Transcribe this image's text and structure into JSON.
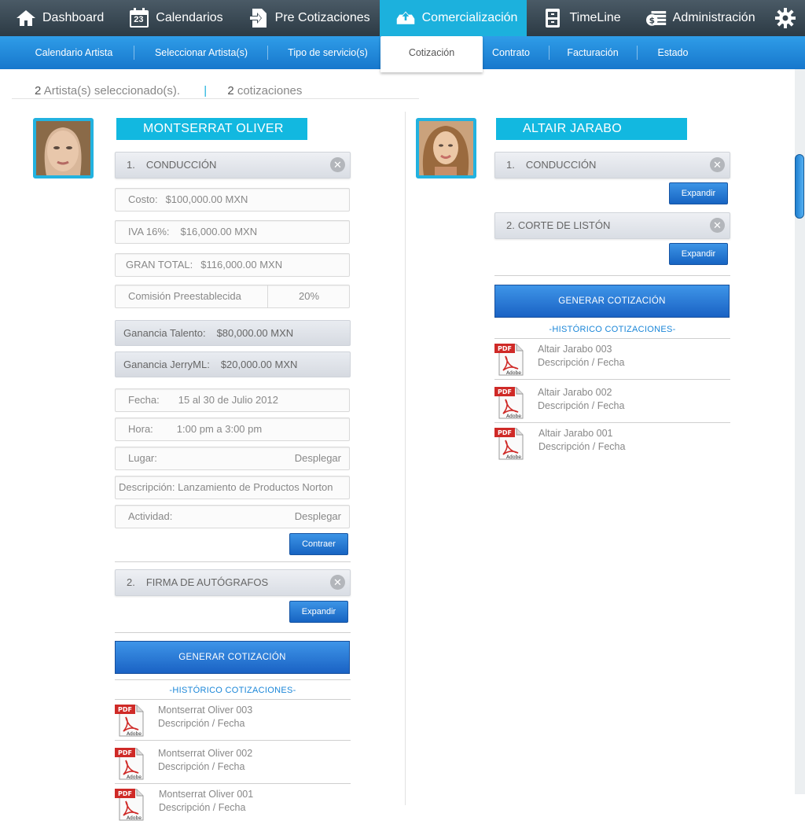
{
  "nav": {
    "items": [
      {
        "label": "Dashboard",
        "icon": "home-icon"
      },
      {
        "label": "Calendarios",
        "icon": "calendar-icon",
        "badge": "23"
      },
      {
        "label": "Pre Cotizaciones",
        "icon": "document-arrow-icon"
      },
      {
        "label": "Comercialización",
        "icon": "cloud-upload-icon"
      },
      {
        "label": "TimeLine",
        "icon": "cabinet-icon"
      },
      {
        "label": "Administración",
        "icon": "money-icon"
      }
    ],
    "active": "Comercialización",
    "settings_icon": "gear-icon"
  },
  "subnav": {
    "items": [
      "Calendario Artista",
      "Seleccionar Artista(s)",
      "Tipo de servicio(s)",
      "Cotización",
      "Contrato",
      "Facturación",
      "Estado"
    ],
    "active": "Cotización"
  },
  "summary": {
    "artists_count": "2",
    "artists_text": "Artista(s) seleccionado(s).",
    "divider": "|",
    "quotes_count": "2",
    "quotes_text": "cotizaciones"
  },
  "artists": [
    {
      "name": "MONTSERRAT OLIVER",
      "services": [
        {
          "num": "1.",
          "label": "CONDUCCIÓN"
        },
        {
          "num": "2.",
          "label": "FIRMA DE AUTÓGRAFOS"
        }
      ],
      "details": {
        "costo_label": "Costo:",
        "costo": "$100,000.00  MXN",
        "iva_label": "IVA 16%:",
        "iva": "$16,000.00 MXN",
        "total_label": "GRAN TOTAL:",
        "total": "$116,000.00  MXN",
        "comision_label": "Comisión Preestablecida",
        "comision": "20%",
        "ganancia_talento_label": "Ganancia Talento:",
        "ganancia_talento": "$80,000.00 MXN",
        "ganancia_jerry_label": "Ganancia JerryML:",
        "ganancia_jerry": "$20,000.00 MXN",
        "fecha_label": "Fecha:",
        "fecha": "15 al 30  de Julio 2012",
        "hora_label": "Hora:",
        "hora": "1:00 pm a 3:00 pm",
        "lugar_label": "Lugar:",
        "lugar_action": "Desplegar",
        "descripcion": "Descripción: Lanzamiento de Productos Norton",
        "actividad_label": "Actividad:",
        "actividad_action": "Desplegar"
      },
      "contraer": "Contraer",
      "expandir": "Expandir",
      "generar": "GENERAR COTIZACIÓN",
      "historico": "-HISTÓRICO COTIZACIONES-",
      "history": [
        {
          "title": "Montserrat Oliver 003",
          "sub": "Descripción / Fecha"
        },
        {
          "title": "Montserrat Oliver 002",
          "sub": "Descripción / Fecha"
        },
        {
          "title": "Montserrat Oliver 001",
          "sub": "Descripción / Fecha"
        }
      ]
    },
    {
      "name": "ALTAIR JARABO",
      "services": [
        {
          "num": "1.",
          "label": "CONDUCCIÓN"
        },
        {
          "num": "2.",
          "label": "CORTE DE LISTÓN"
        }
      ],
      "expandir": "Expandir",
      "generar": "GENERAR COTIZACIÓN",
      "historico": "-HISTÓRICO COTIZACIONES-",
      "history": [
        {
          "title": "Altair Jarabo 003",
          "sub": "Descripción / Fecha"
        },
        {
          "title": "Altair Jarabo 002",
          "sub": "Descripción / Fecha"
        },
        {
          "title": "Altair Jarabo  001",
          "sub": "Descripción / Fecha"
        }
      ]
    }
  ],
  "pdf_icon": {
    "label": "PDF",
    "brand": "Adobe"
  },
  "colors": {
    "accent": "#12b8e0",
    "button": "#1f6fd0",
    "nav_dark": "#34424c"
  }
}
